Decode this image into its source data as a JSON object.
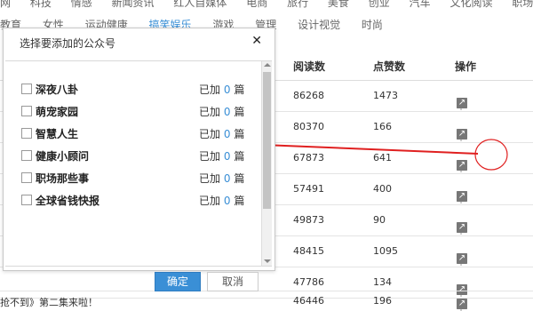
{
  "topnav": {
    "row1": [
      "网",
      "科技",
      "情感",
      "新闻资讯",
      "红人自媒体",
      "电商",
      "旅行",
      "美食",
      "创业",
      "汽车",
      "文化阅读",
      "职场",
      "育儿"
    ],
    "row2": [
      "教育",
      "女性",
      "运动健康",
      "搞笑娱乐",
      "游戏",
      "管理",
      "设计视觉",
      "时尚"
    ],
    "active": "搞笑娱乐"
  },
  "table": {
    "headers": {
      "reads": "阅读数",
      "likes": "点赞数",
      "ops": "操作"
    },
    "rows": [
      {
        "reads": "86268",
        "likes": "1473"
      },
      {
        "reads": "80370",
        "likes": "166"
      },
      {
        "reads": "67873",
        "likes": "641"
      },
      {
        "reads": "57491",
        "likes": "400"
      },
      {
        "reads": "49873",
        "likes": "90"
      },
      {
        "reads": "48415",
        "likes": "1095"
      },
      {
        "reads": "47786",
        "likes": "134"
      }
    ],
    "bottom": {
      "title": "抢不到》第二集来啦！",
      "reads": "46446",
      "likes": "196"
    }
  },
  "modal": {
    "title": "选择要添加的公众号",
    "items": [
      {
        "name": "深夜八卦",
        "prefix": "已加",
        "count": "0",
        "suffix": "篇"
      },
      {
        "name": "萌宠家园",
        "prefix": "已加",
        "count": "0",
        "suffix": "篇"
      },
      {
        "name": "智慧人生",
        "prefix": "已加",
        "count": "0",
        "suffix": "篇"
      },
      {
        "name": "健康小顾问",
        "prefix": "已加",
        "count": "0",
        "suffix": "篇"
      },
      {
        "name": "职场那些事",
        "prefix": "已加",
        "count": "0",
        "suffix": "篇"
      },
      {
        "name": "全球省钱快报",
        "prefix": "已加",
        "count": "0",
        "suffix": "篇"
      }
    ],
    "ok_label": "确定",
    "cancel_label": "取消"
  },
  "colors": {
    "accent": "#3a8fd6",
    "annotation": "#e02020"
  }
}
